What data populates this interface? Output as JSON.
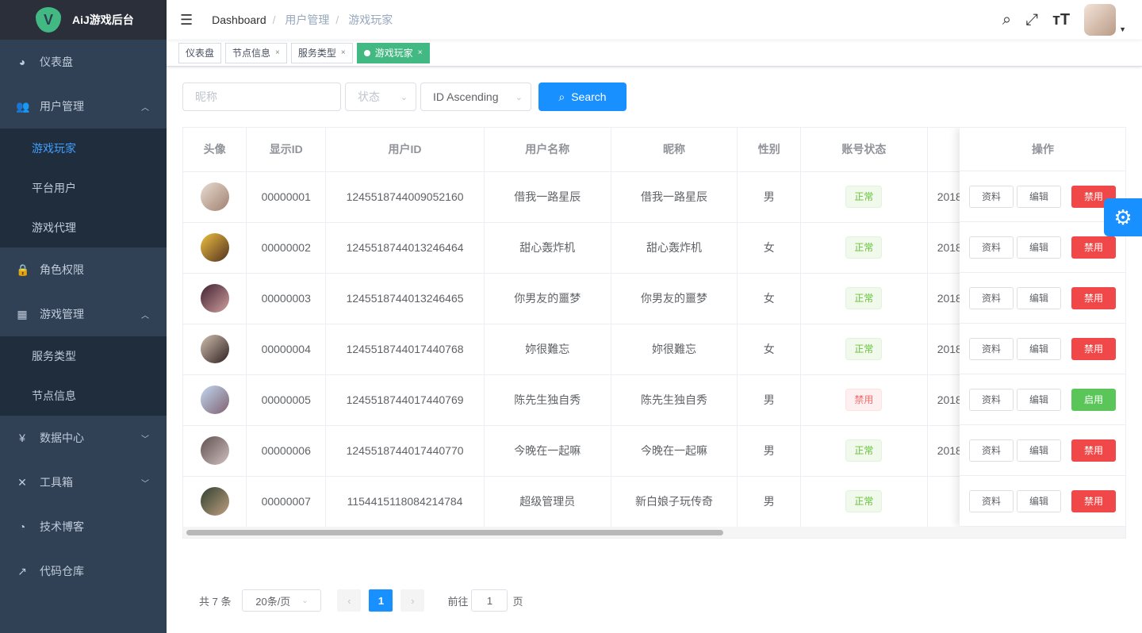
{
  "app": {
    "title": "AiJ游戏后台",
    "logo_letter": "V"
  },
  "sidebar": {
    "items": [
      {
        "label": "仪表盘",
        "icon": "dashboard-icon",
        "glyph": "◕"
      },
      {
        "label": "用户管理",
        "icon": "user-icon",
        "glyph": "👥",
        "expanded": true,
        "children": [
          "游戏玩家",
          "平台用户",
          "游戏代理"
        ]
      },
      {
        "label": "角色权限",
        "icon": "lock-icon",
        "glyph": "🔒"
      },
      {
        "label": "游戏管理",
        "icon": "grid-icon",
        "glyph": "▦",
        "expanded": true,
        "children": [
          "服务类型",
          "节点信息"
        ]
      },
      {
        "label": "数据中心",
        "icon": "yen-icon",
        "glyph": "¥"
      },
      {
        "label": "工具箱",
        "icon": "tools-icon",
        "glyph": "✕"
      },
      {
        "label": "技术博客",
        "icon": "feed-icon",
        "glyph": "◔"
      },
      {
        "label": "代码仓库",
        "icon": "external-link-icon",
        "glyph": "↗"
      }
    ],
    "active": "游戏玩家"
  },
  "breadcrumb": [
    "Dashboard",
    "用户管理",
    "游戏玩家"
  ],
  "tags": [
    {
      "label": "仪表盘"
    },
    {
      "label": "节点信息"
    },
    {
      "label": "服务类型"
    },
    {
      "label": "游戏玩家",
      "active": true
    }
  ],
  "filter": {
    "nickname_placeholder": "昵称",
    "status_placeholder": "状态",
    "sort_value": "ID Ascending",
    "search_label": "Search"
  },
  "table": {
    "headers": [
      "头像",
      "显示ID",
      "用户ID",
      "用户名称",
      "昵称",
      "性别",
      "账号状态",
      "",
      "操作"
    ],
    "rows": [
      {
        "display_id": "00000001",
        "user_id": "1245518744009052160",
        "username": "借我一路星辰",
        "nickname": "借我一路星辰",
        "gender": "男",
        "status": "正常",
        "date": "2018",
        "action": "禁用"
      },
      {
        "display_id": "00000002",
        "user_id": "1245518744013246464",
        "username": "甜心轰炸机",
        "nickname": "甜心轰炸机",
        "gender": "女",
        "status": "正常",
        "date": "2018",
        "action": "禁用"
      },
      {
        "display_id": "00000003",
        "user_id": "1245518744013246465",
        "username": "你男友的噩梦",
        "nickname": "你男友的噩梦",
        "gender": "女",
        "status": "正常",
        "date": "2018",
        "action": "禁用"
      },
      {
        "display_id": "00000004",
        "user_id": "1245518744017440768",
        "username": "妳很難忘",
        "nickname": "妳很難忘",
        "gender": "女",
        "status": "正常",
        "date": "2018",
        "action": "禁用"
      },
      {
        "display_id": "00000005",
        "user_id": "1245518744017440769",
        "username": "陈先生独自秀",
        "nickname": "陈先生独自秀",
        "gender": "男",
        "status": "禁用",
        "date": "2018",
        "action": "启用"
      },
      {
        "display_id": "00000006",
        "user_id": "1245518744017440770",
        "username": "今晚在一起嘛",
        "nickname": "今晚在一起嘛",
        "gender": "男",
        "status": "正常",
        "date": "2018",
        "action": "禁用"
      },
      {
        "display_id": "00000007",
        "user_id": "1154415118084214784",
        "username": "超级管理员",
        "nickname": "新白娘子玩传奇",
        "gender": "男",
        "status": "正常",
        "date": "",
        "action": "禁用"
      }
    ],
    "btn_profile": "资料",
    "btn_edit": "编辑"
  },
  "pagination": {
    "total": "共 7 条",
    "page_size": "20条/页",
    "current": "1",
    "goto_prefix": "前往",
    "goto_value": "1",
    "goto_suffix": "页"
  },
  "colors": {
    "sidebar": "#304156",
    "accent": "#1890ff",
    "tag_active": "#42b983",
    "danger": "#f04848",
    "success": "#5ac65a"
  }
}
